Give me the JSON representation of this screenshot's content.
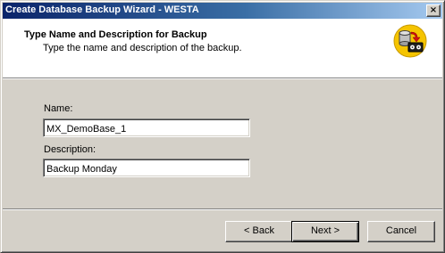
{
  "window": {
    "title": "Create Database Backup Wizard - WESTA",
    "close_label": "×"
  },
  "header": {
    "title": "Type Name and Description for Backup",
    "subtitle": "Type the name and description of the backup.",
    "icon": "database-backup-tape-icon"
  },
  "form": {
    "name_label": "Name:",
    "name_value": "MX_DemoBase_1",
    "description_label": "Description:",
    "description_value": "Backup Monday"
  },
  "buttons": {
    "back_label": "< Back",
    "next_label": "Next >",
    "cancel_label": "Cancel"
  },
  "colors": {
    "titlebar_start": "#0a246a",
    "titlebar_end": "#a6caf0",
    "dialog_face": "#d4d0c8",
    "icon_badge": "#f5c400"
  }
}
